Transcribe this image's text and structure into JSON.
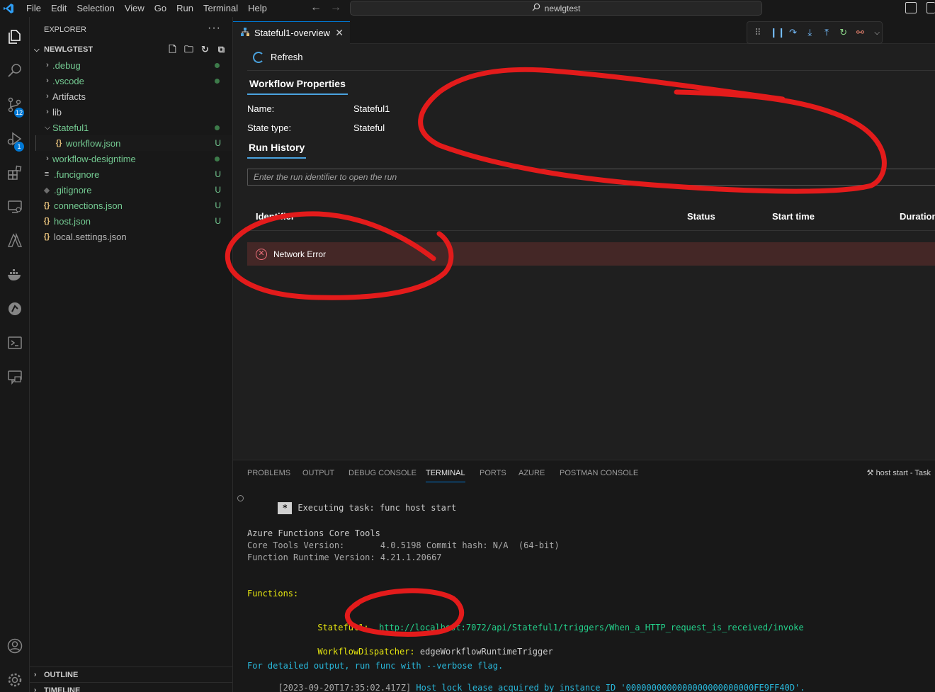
{
  "titlebar": {
    "menu": [
      "File",
      "Edit",
      "Selection",
      "View",
      "Go",
      "Run",
      "Terminal",
      "Help"
    ],
    "search_text": "newlgtest"
  },
  "activity": {
    "source_control_badge": "12",
    "debug_badge": "1"
  },
  "sidebar": {
    "header": "EXPLORER",
    "more": "···",
    "workspace": "NEWLGTEST",
    "items": [
      {
        "label": ".debug",
        "deco": ""
      },
      {
        "label": ".vscode",
        "deco": ""
      },
      {
        "label": "Artifacts",
        "deco": ""
      },
      {
        "label": "lib",
        "deco": ""
      },
      {
        "label": "Stateful1",
        "deco": ""
      },
      {
        "label": "workflow.json",
        "deco": "U"
      },
      {
        "label": "workflow-designtime",
        "deco": ""
      },
      {
        "label": ".funcignore",
        "deco": "U"
      },
      {
        "label": ".gitignore",
        "deco": "U"
      },
      {
        "label": "connections.json",
        "deco": "U"
      },
      {
        "label": "host.json",
        "deco": "U"
      },
      {
        "label": "local.settings.json",
        "deco": ""
      }
    ],
    "outline": "OUTLINE",
    "timeline": "TIMELINE"
  },
  "editor": {
    "tab_label": "Stateful1-overview",
    "refresh_label": "Refresh",
    "workflow_properties_label": "Workflow Properties",
    "name_key": "Name:",
    "name_value": "Stateful1",
    "state_type_key": "State type:",
    "state_type_value": "Stateful",
    "run_history_label": "Run History",
    "run_input_placeholder": "Enter the run identifier to open the run",
    "columns": [
      "Identifier",
      "Status",
      "Start time",
      "Duration"
    ],
    "error_text": "Network Error"
  },
  "panel": {
    "tabs": [
      "PROBLEMS",
      "OUTPUT",
      "DEBUG CONSOLE",
      "TERMINAL",
      "PORTS",
      "AZURE",
      "POSTMAN CONSOLE"
    ],
    "task_label": "host start - Task",
    "terminal": {
      "executing": "Executing task: func host start",
      "tools_title": "Azure Functions Core Tools",
      "core_tools_version": "Core Tools Version:       4.0.5198 Commit hash: N/A  (64-bit)",
      "runtime_version": "Function Runtime Version: 4.21.1.20667",
      "functions_label": "Functions:",
      "stateful_name": "Stateful1:",
      "stateful_url": "http://localhost:7072/api/Stateful1/triggers/When_a_HTTP_request_is_received/invoke",
      "dispatcher_name": "WorkflowDispatcher:",
      "dispatcher_value": " edgeWorkflowRuntimeTrigger",
      "verbose_hint": "For detailed output, run func with --verbose flag.",
      "log_time": "[2023-09-20T17:35:02.417Z]",
      "log_msg": " Host lock lease acquired by instance ID '0000000000000000000000000FE9FF40D'."
    }
  },
  "colors": {
    "accent": "#0078d4",
    "git_untracked": "#73c991",
    "error_bg": "#442726",
    "annotation_red": "#e31b1b"
  }
}
